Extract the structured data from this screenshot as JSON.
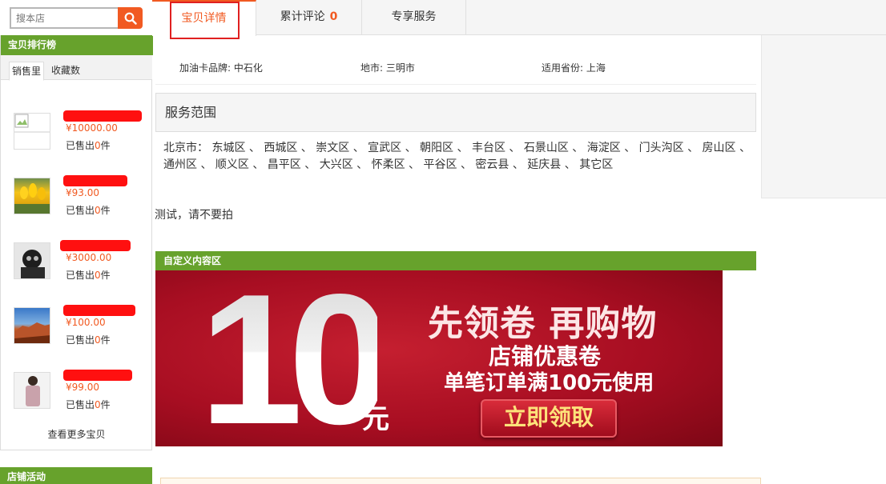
{
  "search": {
    "placeholder": "搜本店"
  },
  "rank": {
    "title": "宝贝排行榜",
    "tabs": [
      "销售里",
      "收藏数"
    ],
    "sold_prefix": "已售出",
    "sold_suffix": "件",
    "items": [
      {
        "price": "¥10000.00",
        "sold": "0"
      },
      {
        "price": "¥93.00",
        "sold": "0"
      },
      {
        "price": "¥3000.00",
        "sold": "0"
      },
      {
        "price": "¥100.00",
        "sold": "0"
      },
      {
        "price": "¥99.00",
        "sold": "0"
      }
    ],
    "more": "查看更多宝贝"
  },
  "shop_activity": {
    "title": "店铺活动"
  },
  "tabs": {
    "detail": "宝贝详情",
    "reviews": "累计评论",
    "reviews_count": "0",
    "service": "专享服务"
  },
  "attributes": {
    "brand": "加油卡品牌: 中石化",
    "city": "地市: 三明市",
    "province": "适用省份: 上海"
  },
  "service_scope": {
    "title": "服务范围",
    "area_line1": "北京市：  东城区 、 西城区 、 崇文区 、 宣武区 、 朝阳区 、 丰台区 、 石景山区 、 海淀区 、 门头沟区 、 房山区 、",
    "area_line2": "通州区 、 顺义区 、 昌平区 、 大兴区 、 怀柔区 、 平谷区 、 密云县 、 延庆县 、 其它区"
  },
  "description": "测试，请不要拍",
  "custom_area": {
    "title": "自定义内容区"
  },
  "banner": {
    "number": "10",
    "unit": "元",
    "title": "先领卷 再购物",
    "sub1": "店铺优惠卷",
    "sub2": "单笔订单满100元使用",
    "button": "立即领取"
  },
  "colors": {
    "accent": "#f15a22",
    "green": "#67a22c",
    "highlight": "#e02020"
  }
}
